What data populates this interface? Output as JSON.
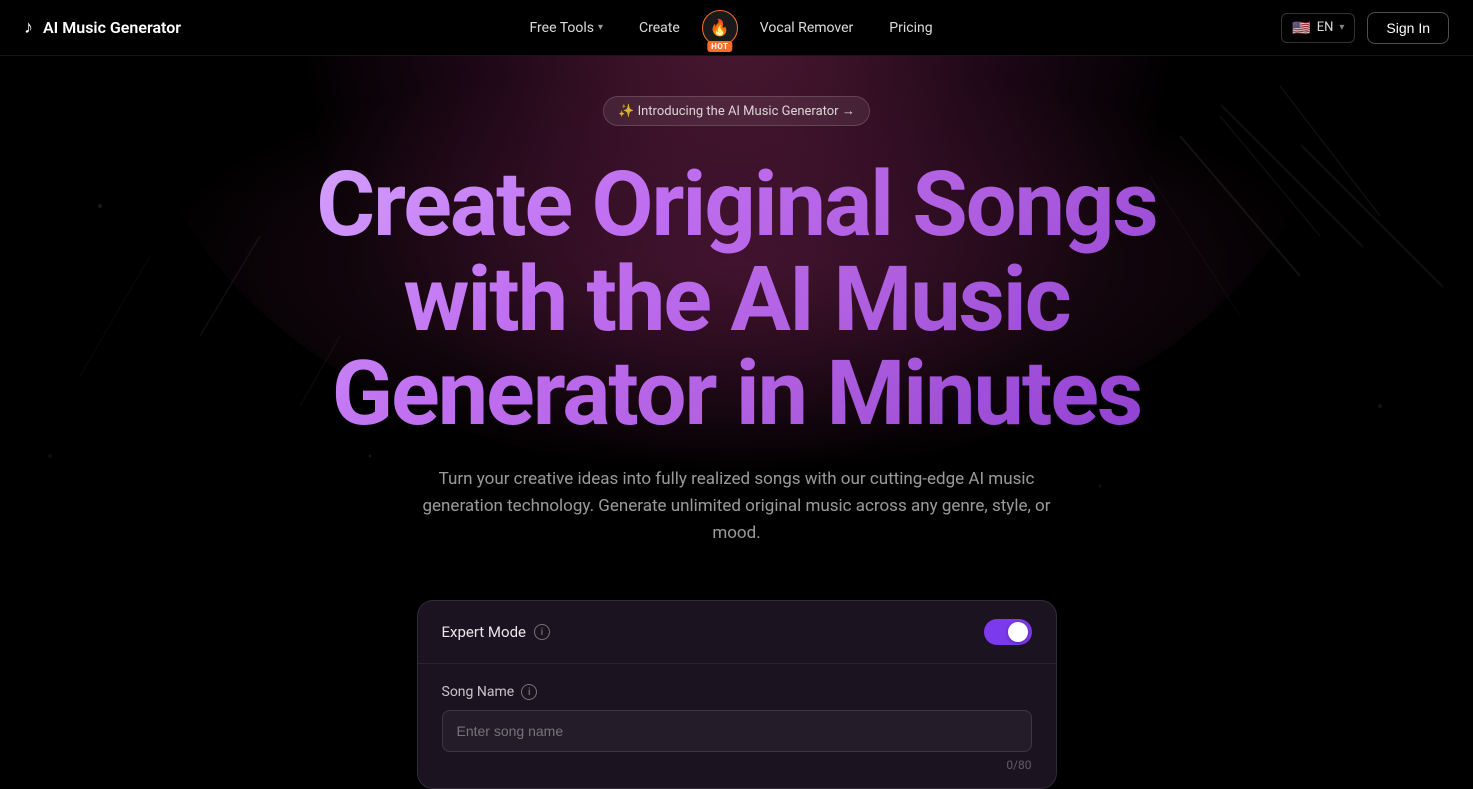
{
  "brand": {
    "icon": "♪",
    "name": "AI Music Generator"
  },
  "nav": {
    "free_tools_label": "Free Tools",
    "create_label": "Create",
    "hot_emoji": "🔥",
    "hot_text": "HOT",
    "vocal_remover_label": "Vocal Remover",
    "pricing_label": "Pricing"
  },
  "language": {
    "flag": "🇺🇸",
    "code": "EN"
  },
  "auth": {
    "sign_in_label": "Sign In"
  },
  "hero": {
    "badge_text": "✨ Introducing the AI Music Generator →",
    "title_line1": "Create Original Songs",
    "title_line2": "with the AI Music",
    "title_line3": "Generator in Minutes",
    "subtitle": "Turn your creative ideas into fully realized songs with our cutting-edge AI music generation technology. Generate unlimited original music across any genre, style, or mood."
  },
  "form": {
    "expert_mode_label": "Expert Mode",
    "expert_mode_info": "i",
    "toggle_on": true,
    "song_name_label": "Song Name",
    "song_name_info": "i",
    "song_name_placeholder": "Enter song name",
    "song_name_value": "",
    "char_count": "0/80"
  }
}
